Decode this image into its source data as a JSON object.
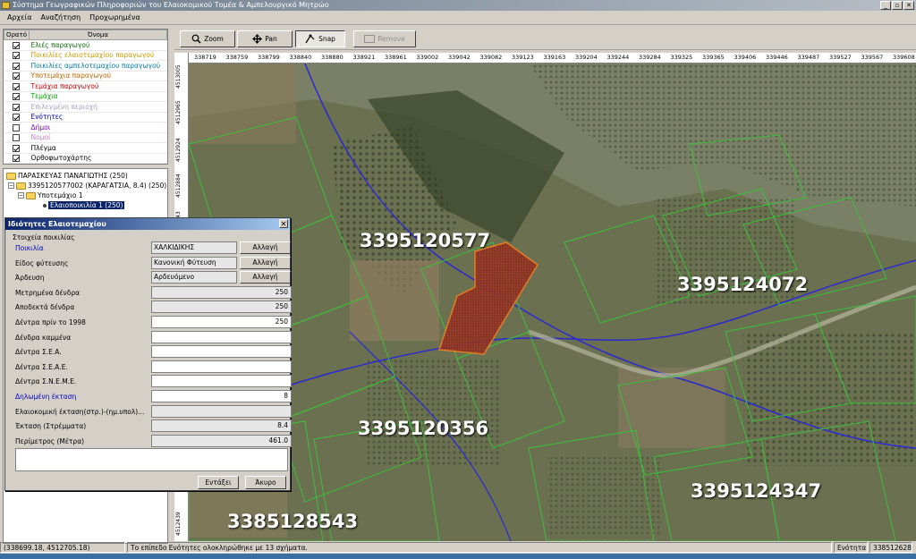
{
  "window": {
    "title": "Σύστημα Γεωγραφικών Πληροφοριών του Ελαιοκομικού Τομέα & Αμπελουργικό Μητρώο",
    "controls": [
      "_",
      "▫",
      "✕"
    ]
  },
  "menu": [
    "Αρχεία",
    "Αναζήτηση",
    "Προχωρημένα"
  ],
  "layers": {
    "headers": {
      "visible": "Ορατό",
      "name": "Όνομα"
    },
    "items": [
      {
        "name": "Ελιές παραγωγού",
        "checked": true,
        "color": "#0a6a0a"
      },
      {
        "name": "Ποικιλίες ελαιοτεμαχίου παραγωγού",
        "checked": true,
        "color": "#c89a00"
      },
      {
        "name": "Ποικιλίες αμπελοτεμαχίου παραγωγού",
        "checked": true,
        "color": "#0078a8"
      },
      {
        "name": "Υποτεμάχια παραγωγού",
        "checked": true,
        "color": "#c86400"
      },
      {
        "name": "Τεμάχια παραγωγού",
        "checked": true,
        "color": "#c00000"
      },
      {
        "name": "Τεμάχια",
        "checked": true,
        "color": "#00a000"
      },
      {
        "name": "Επιλεγμένη περιοχή",
        "checked": true,
        "color": "#a0a0c0"
      },
      {
        "name": "Ενότητες",
        "checked": true,
        "color": "#0000a0"
      },
      {
        "name": "Δήμοι",
        "checked": false,
        "color": "#8000c0"
      },
      {
        "name": "Νομοί",
        "checked": false,
        "color": "#c080c0"
      },
      {
        "name": "Πλέγμα",
        "checked": true,
        "color": "#000000"
      },
      {
        "name": "Ορθοφωτοχάρτης",
        "checked": true,
        "color": "#000000"
      }
    ]
  },
  "tree": {
    "root": "ΠΑΡΑΣΚΕΥΑΣ ΠΑΝΑΓΙΩΤΗΣ (250)",
    "parcel": "3395120577002 (ΚΑΡΑΓΑΤΣΙΑ, 8.4) (250)",
    "subparcel": "Υποτεμάχιο 1",
    "variety": "Ελαιοποικιλία 1 (250)"
  },
  "dialog": {
    "title": "Ιδιότητες Ελαιοτεμαχίου",
    "subtitle": "Στοιχεία ποικιλίας",
    "change_label": "Αλλαγή",
    "ok_label": "Εντάξει",
    "cancel_label": "Άκυρο",
    "fields": [
      {
        "label": "Ποικιλία",
        "value": "ΧΑΛΚΙΔΙΚΗΣ",
        "blue": true,
        "kind": "select"
      },
      {
        "label": "Είδος φύτευσης",
        "value": "Κανονική Φύτευση",
        "blue": false,
        "kind": "select"
      },
      {
        "label": "Άρδευση",
        "value": "Αρδευόμενο",
        "blue": false,
        "kind": "select"
      },
      {
        "label": "Μετρημένα δένδρα",
        "value": "250",
        "blue": false,
        "kind": "ro"
      },
      {
        "label": "Αποδεκτά δένδρα",
        "value": "250",
        "blue": false,
        "kind": "ro"
      },
      {
        "label": "Δέντρα πρίν το 1998",
        "value": "250",
        "blue": false,
        "kind": "edit"
      },
      {
        "label": "Δένδρα καμμένα",
        "value": "",
        "blue": false,
        "kind": "edit"
      },
      {
        "label": "Δέντρα Σ.Ε.Α.",
        "value": "",
        "blue": false,
        "kind": "edit"
      },
      {
        "label": "Δέντρα Σ.Ε.Α.Ε.",
        "value": "",
        "blue": false,
        "kind": "edit"
      },
      {
        "label": "Δέντρα Σ.Ν.Ε.Μ.Ε.",
        "value": "",
        "blue": false,
        "kind": "edit"
      },
      {
        "label": "Δηλωμένη έκταση",
        "value": "8",
        "blue": true,
        "kind": "edit"
      },
      {
        "label": "Ελαιοκομική έκταση(στρ.)-(ημ.υπολ)...",
        "value": "",
        "blue": false,
        "kind": "ro"
      },
      {
        "label": "Έκταση (Στρέμματα)",
        "value": "8.4",
        "blue": false,
        "kind": "ro"
      },
      {
        "label": "Περίμετρος (Μέτρα)",
        "value": "461.0",
        "blue": false,
        "kind": "ro"
      }
    ]
  },
  "toolbar": {
    "zoom": "Zoom",
    "pan": "Pan",
    "snap": "Snap",
    "remove": "Remove"
  },
  "ruler": {
    "x": [
      "338719",
      "338759",
      "338799",
      "338840",
      "338880",
      "338921",
      "338961",
      "339002",
      "339042",
      "339082",
      "339123",
      "339163",
      "339204",
      "339244",
      "339284",
      "339325",
      "339365",
      "339406",
      "339446",
      "339487",
      "339527",
      "339567",
      "339608"
    ],
    "y": [
      "4513005",
      "4512965",
      "4512924",
      "4512884",
      "4512843",
      "4512439"
    ]
  },
  "map": {
    "labels": [
      "3395120577",
      "3395124072",
      "3395120356",
      "3395124347",
      "3385128543"
    ]
  },
  "status": {
    "coords": "(338699.18, 4512705.18)",
    "message": "Το επίπεδο Ενότητες ολοκληρώθηκε με 13 σχήματα.",
    "unit_label": "Ενότητα",
    "unit_value": "3385126282"
  }
}
